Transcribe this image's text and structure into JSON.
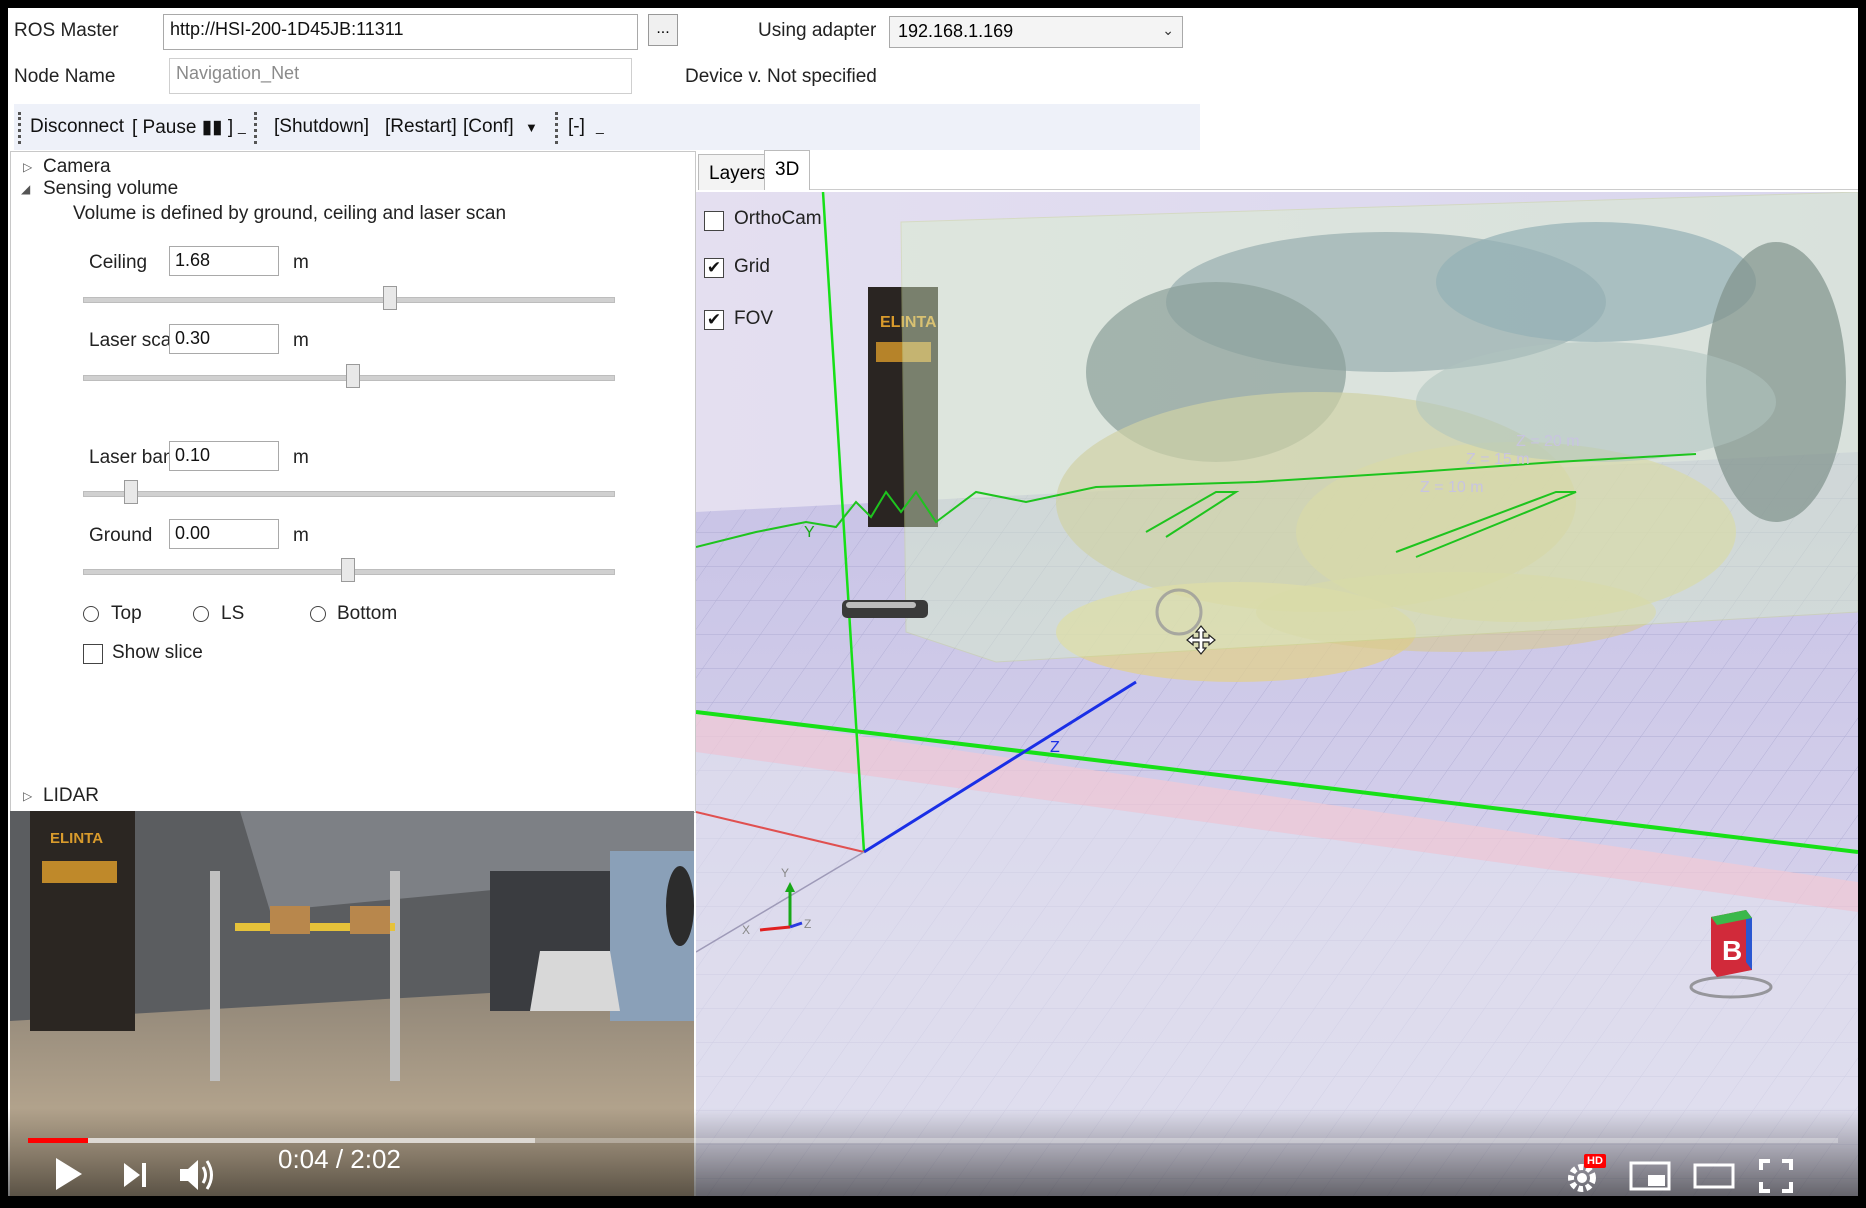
{
  "header": {
    "ros_master_label": "ROS Master",
    "ros_master_value": "http://HSI-200-1D45JB:11311",
    "browse_label": "...",
    "node_name_label": "Node Name",
    "node_name_placeholder": "Navigation_Net",
    "adapter_label": "Using adapter",
    "adapter_value": "192.168.1.169",
    "device_label": "Device v. Not specified"
  },
  "toolbar": {
    "disconnect": "Disconnect",
    "pause": "[ Pause ▮▮ ]",
    "shutdown": "[Shutdown]",
    "restart": "[Restart]",
    "conf": "[Conf]",
    "collapse": "[-]"
  },
  "tree": {
    "camera": "Camera",
    "sensing_volume": "Sensing volume",
    "description": "Volume is defined by ground, ceiling and laser scan",
    "lidar": "LIDAR"
  },
  "sensing": {
    "ceiling": {
      "label": "Ceiling",
      "value": "1.68",
      "unit": "m",
      "level": 0.58
    },
    "laser_scan": {
      "label": "Laser scar",
      "value": "0.30",
      "unit": "m",
      "level": 0.51
    },
    "laser_band": {
      "label": "Laser ban",
      "value": "0.10",
      "unit": "m",
      "level": 0.09
    },
    "ground": {
      "label": "Ground",
      "value": "0.00",
      "unit": "m",
      "level": 0.5
    }
  },
  "radios": {
    "top": "Top",
    "ls": "LS",
    "bottom": "Bottom"
  },
  "show_slice": "Show slice",
  "tabs": {
    "layers": "Layers",
    "three_d": "3D"
  },
  "layers": {
    "orthocam": {
      "label": "OrthoCam",
      "checked": false
    },
    "grid": {
      "label": "Grid",
      "checked": true
    },
    "fov": {
      "label": "FOV",
      "checked": true
    }
  },
  "scene_labels": {
    "y_axis": "Y",
    "z_axis": "Z",
    "z20": "Z = 20 m",
    "z15": "Z = 15 m",
    "z10": "Z = 10 m",
    "gizmo_x": "X",
    "gizmo_y": "Y",
    "gizmo_z": "Z",
    "camera_logo": "ELINTA",
    "booth_logo": "ELINTA"
  },
  "player": {
    "time": "0:04 / 2:02",
    "progress": 0.033,
    "buffered": 0.28,
    "hd_badge": "HD",
    "channel_logo": "B"
  },
  "colors": {
    "progress": "#ff0000",
    "grid_green": "#17e017",
    "axis_blue": "#1a2fe6"
  }
}
